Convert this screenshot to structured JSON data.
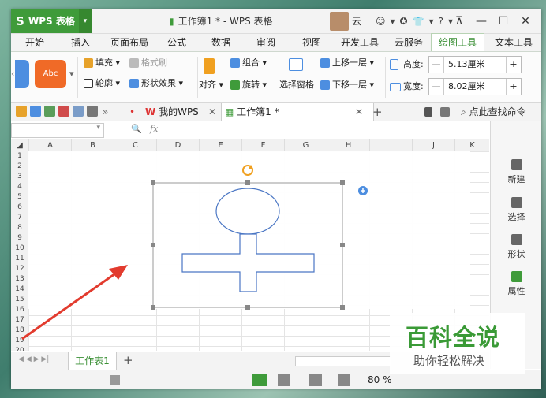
{
  "app": {
    "logo": "S",
    "name": "WPS 表格",
    "caret": "▾"
  },
  "title": "工作簿1 * - WPS 表格",
  "user": "云",
  "title_icons": [
    "☺",
    "▾",
    "✪",
    "👕",
    "▾",
    "?",
    "▾"
  ],
  "window_controls": {
    "minimize": "—",
    "restore": "☐",
    "close": "✕"
  },
  "tabs": [
    "开始",
    "插入",
    "页面布局",
    "公式",
    "数据",
    "审阅",
    "视图",
    "开发工具",
    "云服务",
    "绘图工具",
    "文本工具"
  ],
  "active_tab": "绘图工具",
  "ribbon": {
    "style_sample": "Abc",
    "fill": "填充",
    "format_brush": "格式刷",
    "outline": "轮廓",
    "shape_effect": "形状效果",
    "align": "对齐",
    "group": "组合",
    "rotate": "旋转",
    "selection_pane": "选择窗格",
    "bring_forward": "上移一层",
    "send_backward": "下移一层",
    "height_label": "高度:",
    "height_value": "5.13厘米",
    "width_label": "宽度:",
    "width_value": "8.02厘米",
    "minus": "—",
    "plus": "+"
  },
  "doc_tabs": {
    "my_wps": "我的WPS",
    "workbook": "工作簿1 *",
    "close": "✕",
    "add": "+"
  },
  "search_command": "点此查找命令",
  "formula": {
    "zoom_icon": "🔍",
    "fx": "fx"
  },
  "columns": [
    "A",
    "B",
    "C",
    "D",
    "E",
    "F",
    "G",
    "H",
    "I",
    "J",
    "K"
  ],
  "rows": [
    "1",
    "2",
    "3",
    "4",
    "5",
    "6",
    "7",
    "8",
    "9",
    "10",
    "11",
    "12",
    "13",
    "14",
    "15",
    "16",
    "17",
    "18",
    "19",
    "20"
  ],
  "sheet_tab": "工作表1",
  "status": {
    "zoom": "80 %"
  },
  "right_panel": [
    "新建",
    "选择",
    "形状",
    "属性"
  ],
  "watermark": {
    "title": "百科全说",
    "subtitle": "助你轻松解决"
  },
  "colors": {
    "accent": "#3f9b3a",
    "shape_stroke": "#4a76c4",
    "arrow": "#e23b2e",
    "handle": "#888888",
    "rotate": "#f0a020"
  }
}
